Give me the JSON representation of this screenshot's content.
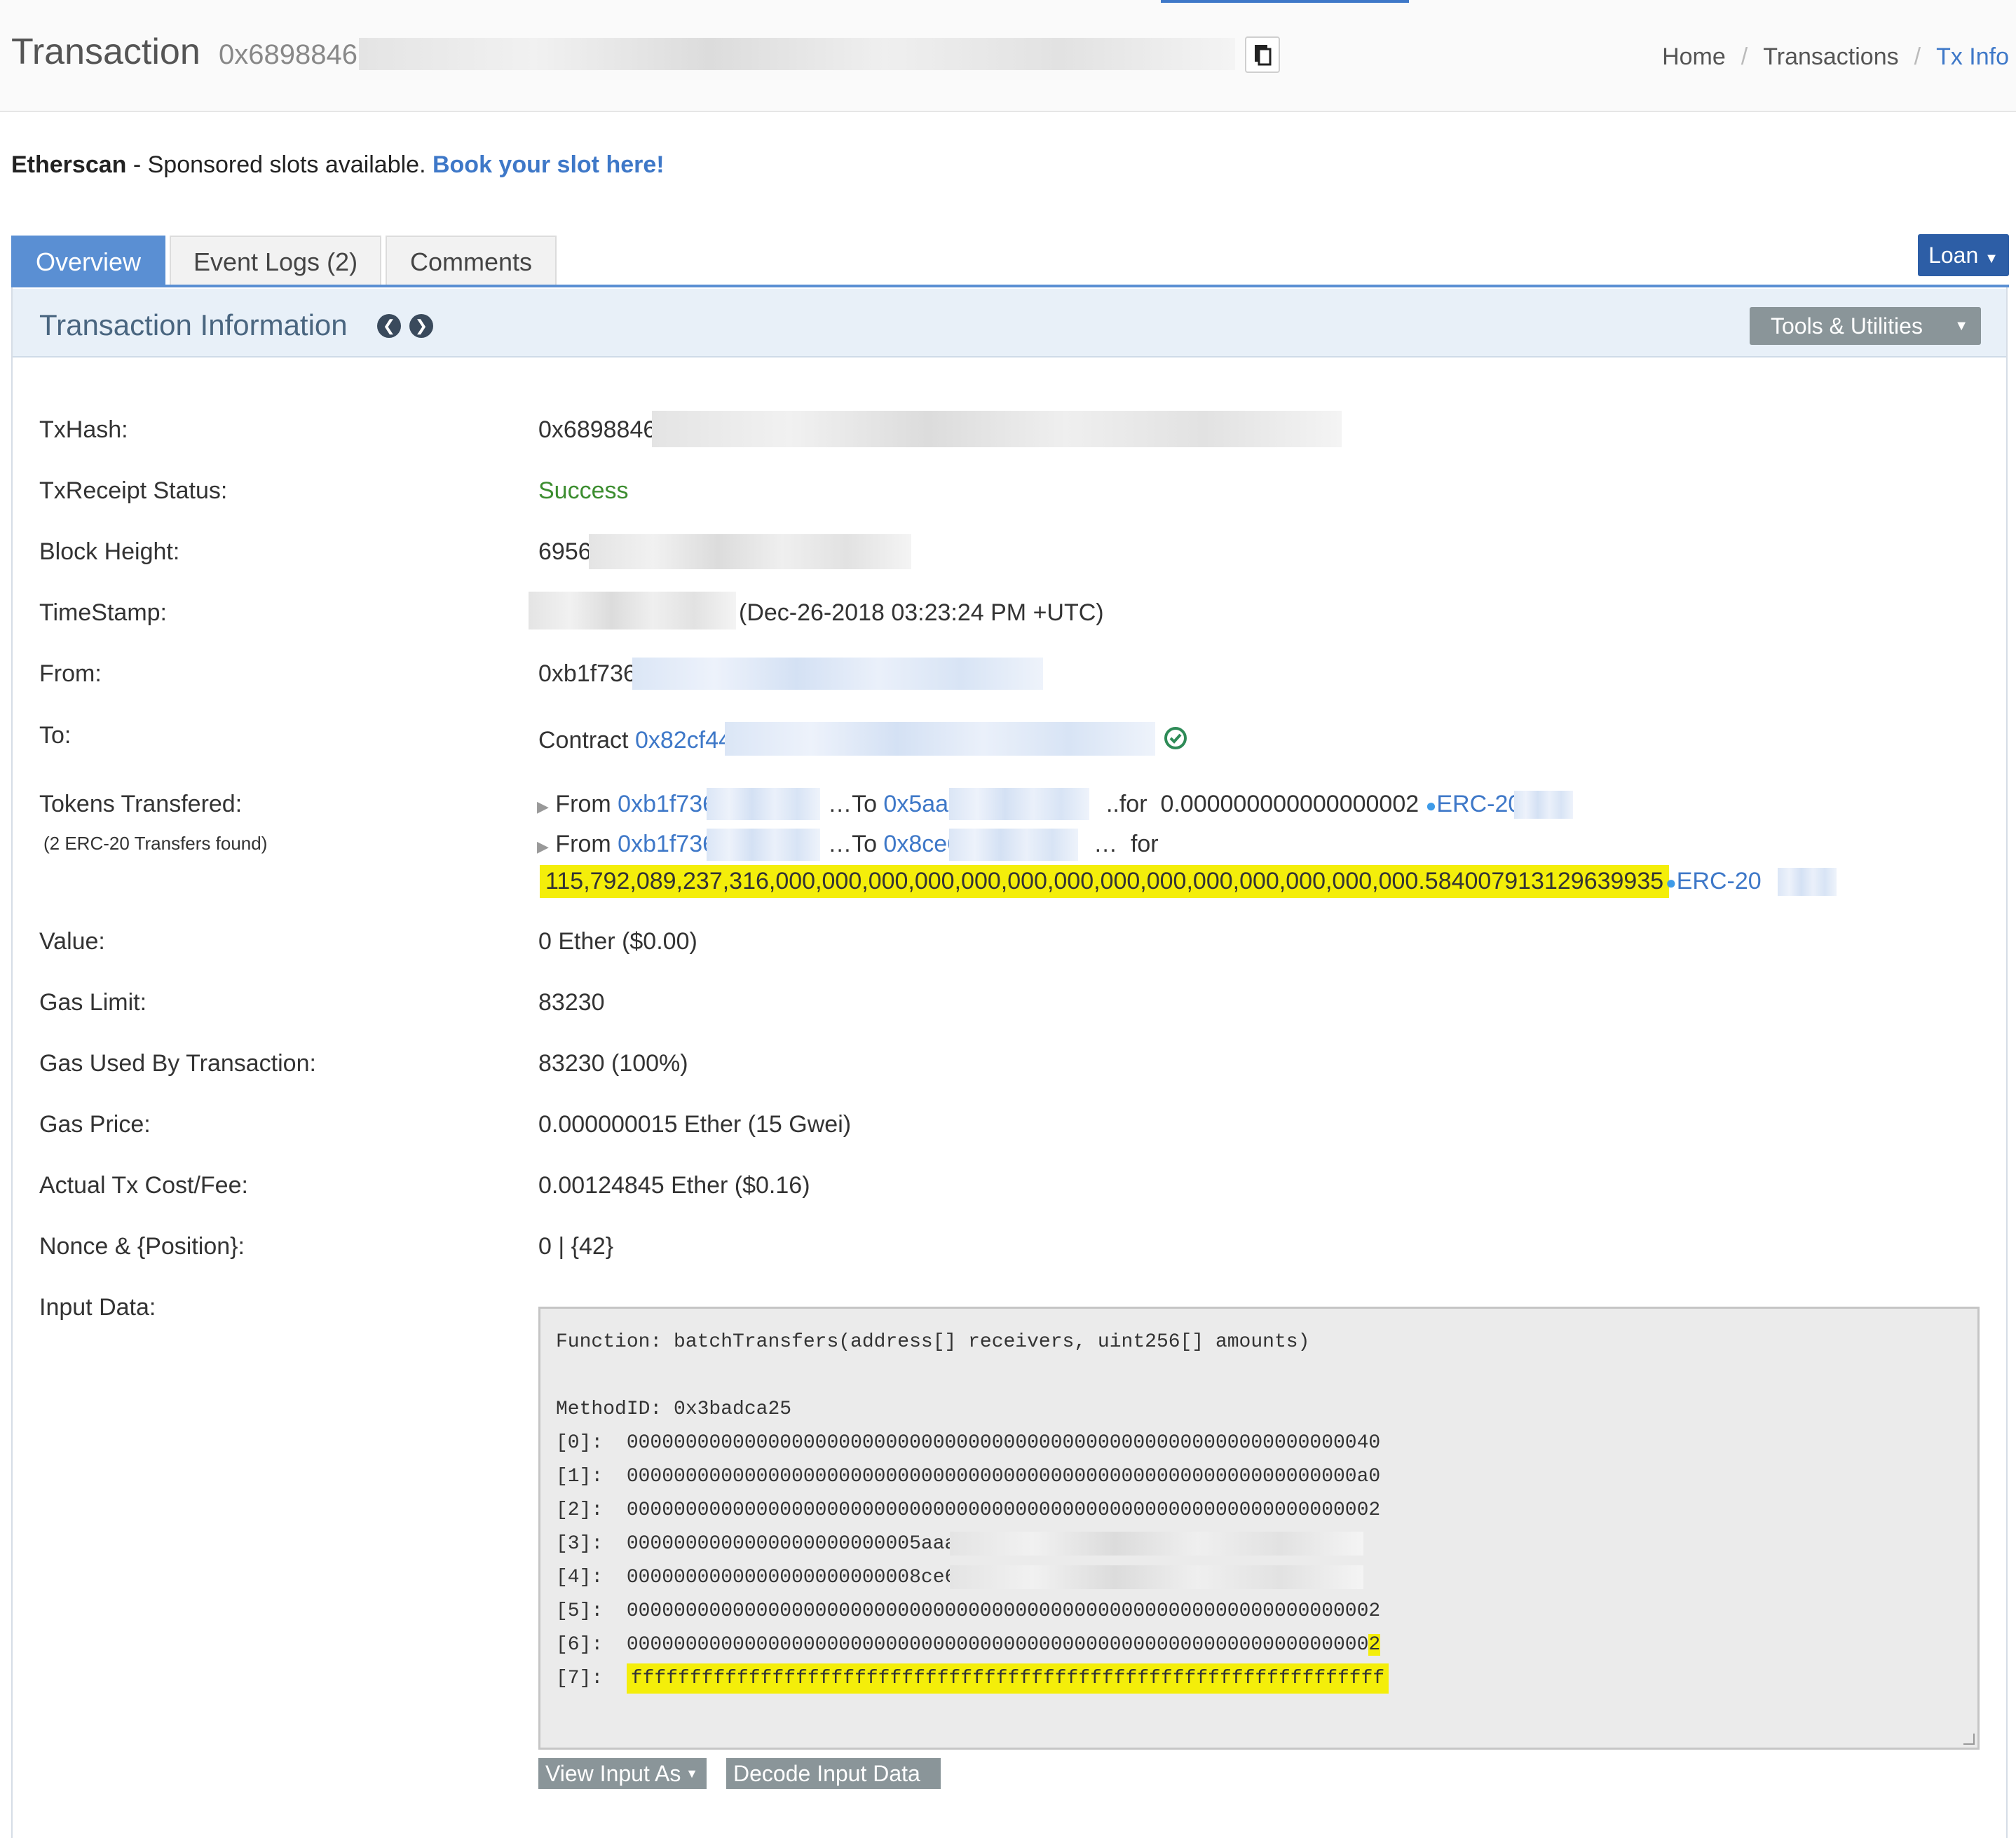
{
  "header": {
    "title": "Transaction",
    "hash_prefix": "0x6898846",
    "breadcrumb": [
      "Home",
      "Transactions",
      "Tx Info"
    ]
  },
  "sponsor": {
    "brand": "Etherscan",
    "text": " - Sponsored slots available. ",
    "link": "Book your slot here!"
  },
  "tabs": [
    "Overview",
    "Event Logs (2)",
    "Comments"
  ],
  "loan_label": "Loan",
  "panel": {
    "title": "Transaction Information",
    "tools_label": "Tools & Utilities"
  },
  "rows": {
    "txhash": {
      "label": "TxHash:",
      "value": "0x6898846"
    },
    "status": {
      "label": "TxReceipt Status:",
      "value": "Success"
    },
    "block": {
      "label": "Block Height:",
      "value": "6956"
    },
    "timestamp": {
      "label": "TimeStamp:",
      "value": "(Dec-26-2018 03:23:24 PM +UTC)"
    },
    "from": {
      "label": "From:",
      "value": "0xb1f736"
    },
    "to": {
      "label": "To:",
      "prefix": "Contract ",
      "value": "0x82cf44"
    },
    "tokens": {
      "label": "Tokens Transfered:",
      "sublabel": "(2 ERC-20 Transfers found)",
      "transfers": [
        {
          "from": "0xb1f736",
          "to": "0x5aaa",
          "amount": "0.000000000000000002",
          "token": "ERC-20"
        },
        {
          "from": "0xb1f736",
          "to": "0x8ce6",
          "amount": "115,792,089,237,316,000,000,000,000,000,000,000,000,000,000,000,000,000,000.584007913129639935",
          "token": "ERC-20"
        }
      ]
    },
    "value": {
      "label": "Value:",
      "value": "0 Ether ($0.00)"
    },
    "gas_limit": {
      "label": "Gas Limit:",
      "value": "83230"
    },
    "gas_used": {
      "label": "Gas Used By Transaction:",
      "value": "83230 (100%)"
    },
    "gas_price": {
      "label": "Gas Price:",
      "value": "0.000000015 Ether (15 Gwei)"
    },
    "fee": {
      "label": "Actual Tx Cost/Fee:",
      "value": "0.00124845 Ether ($0.16)"
    },
    "nonce": {
      "label": "Nonce & {Position}:",
      "value": "0 | {42}"
    },
    "input": {
      "label": "Input Data:"
    }
  },
  "input_data": {
    "function": "Function: batchTransfers(address[] receivers, uint256[] amounts)",
    "method_id": "MethodID: 0x3badca25",
    "params": [
      {
        "idx": "[0]:",
        "value": "0000000000000000000000000000000000000000000000000000000000000040"
      },
      {
        "idx": "[1]:",
        "value": "00000000000000000000000000000000000000000000000000000000000000a0"
      },
      {
        "idx": "[2]:",
        "value": "0000000000000000000000000000000000000000000000000000000000000002"
      },
      {
        "idx": "[3]:",
        "value": "0000000000000000000000005aaa"
      },
      {
        "idx": "[4]:",
        "value": "0000000000000000000000008ce6"
      },
      {
        "idx": "[5]:",
        "value": "0000000000000000000000000000000000000000000000000000000000000002"
      },
      {
        "idx": "[6]:",
        "value": "000000000000000000000000000000000000000000000000000000000000000",
        "tail": "2"
      },
      {
        "idx": "[7]:",
        "value": "ffffffffffffffffffffffffffffffffffffffffffffffffffffffffffffffff"
      }
    ]
  },
  "buttons": {
    "view_input": "View Input As",
    "decode": "Decode Input Data"
  },
  "colors": {
    "accent": "#3e78c8",
    "tab_active": "#5a8fd3",
    "success": "#3c8d2f",
    "highlight": "#f4ee0a"
  }
}
